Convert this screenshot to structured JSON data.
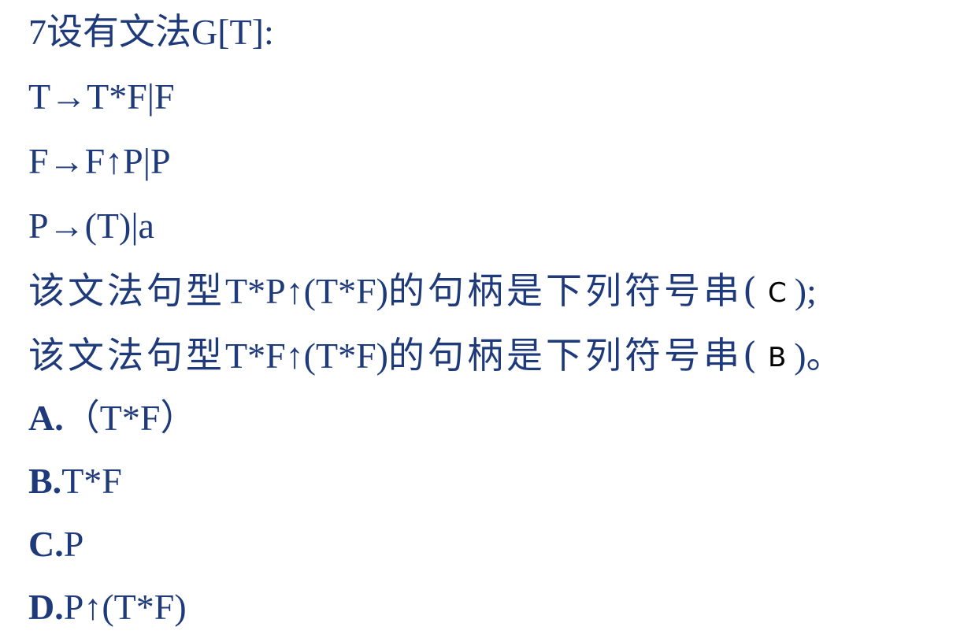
{
  "title": "7设有文法G[T]:",
  "productions": [
    "T→T*F|F",
    "F→F↑P|P",
    "P→(T)|a"
  ],
  "questions": [
    {
      "prefix_cjk": "该文法句型",
      "sentence": "T*P↑(T*F)",
      "suffix_cjk": "的句柄是下列符号串(",
      "answer": "C",
      "close": ");"
    },
    {
      "prefix_cjk": "该文法句型",
      "sentence": "T*F↑(T*F)",
      "suffix_cjk": "的句柄是下列符号串(",
      "answer": "B",
      "close": ")。"
    }
  ],
  "options": [
    {
      "letter": "A.",
      "text": "（T*F）"
    },
    {
      "letter": "B.",
      "text": "T*F"
    },
    {
      "letter": "C.",
      "text": "P"
    },
    {
      "letter": "D.",
      "text": "P↑(T*F)"
    }
  ],
  "colors": {
    "text": "#1f3a7a",
    "answer": "#000000",
    "background": "#ffffff"
  }
}
